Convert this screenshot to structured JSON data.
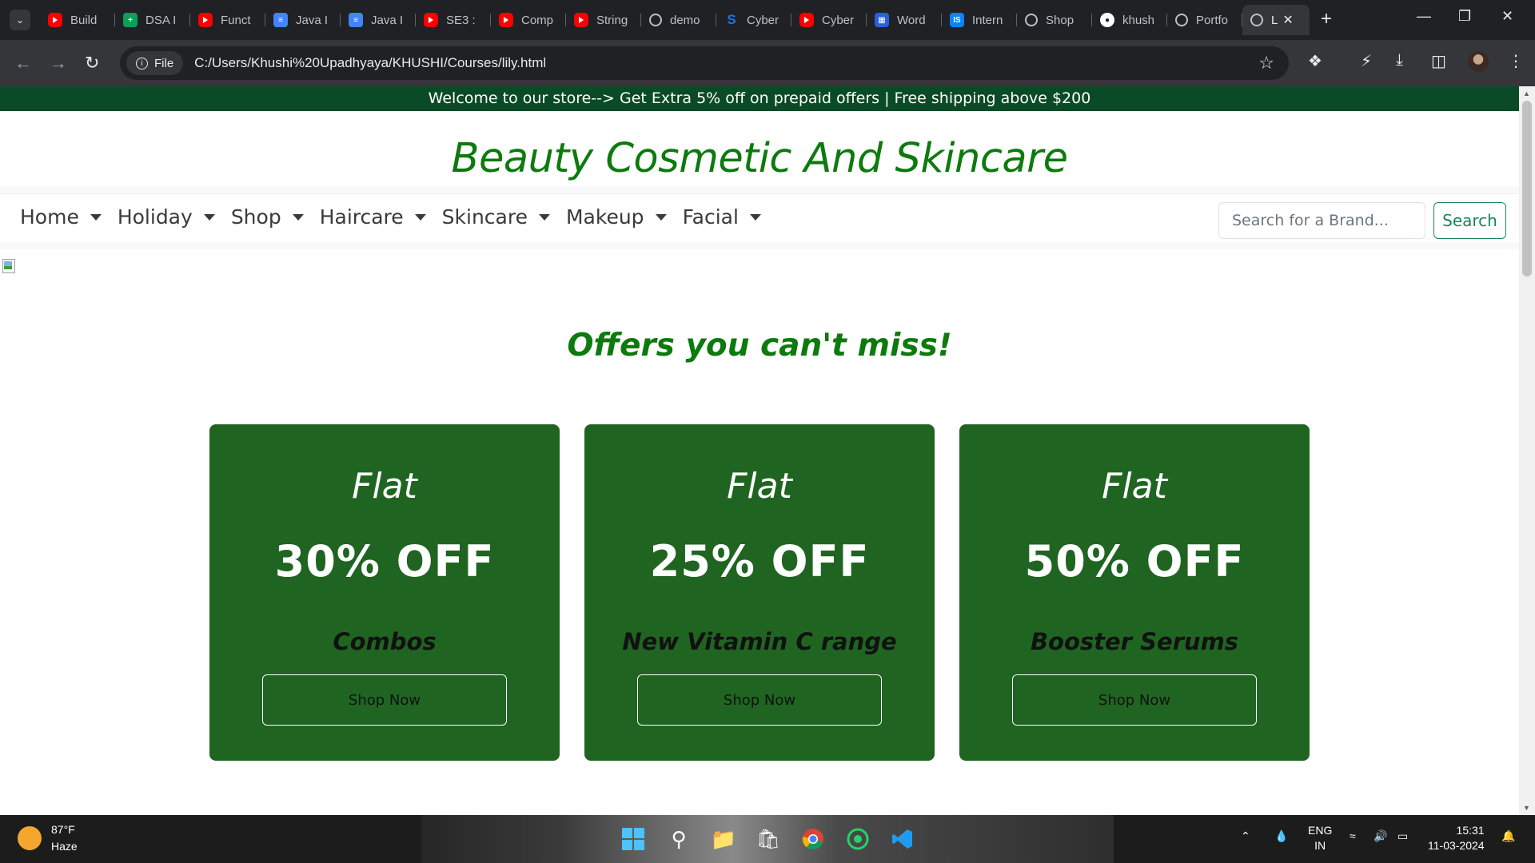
{
  "browser": {
    "tabs": [
      {
        "icon": "youtube-icon",
        "title": "Build"
      },
      {
        "icon": "sheets-icon",
        "title": "DSA I"
      },
      {
        "icon": "youtube-icon",
        "title": "Funct"
      },
      {
        "icon": "docs-icon",
        "title": "Java I"
      },
      {
        "icon": "docs-icon",
        "title": "Java I"
      },
      {
        "icon": "youtube-icon",
        "title": "SE3 :"
      },
      {
        "icon": "youtube-icon",
        "title": "Comp"
      },
      {
        "icon": "youtube-icon",
        "title": "String"
      },
      {
        "icon": "globe-icon",
        "title": "demo"
      },
      {
        "icon": "s-icon",
        "title": "Cyber"
      },
      {
        "icon": "youtube-icon",
        "title": "Cyber"
      },
      {
        "icon": "grid-icon",
        "title": "Word"
      },
      {
        "icon": "is-icon",
        "title": "Intern"
      },
      {
        "icon": "globe-icon",
        "title": "Shop"
      },
      {
        "icon": "github-icon",
        "title": "khush"
      },
      {
        "icon": "globe-icon",
        "title": "Portfo"
      }
    ],
    "active_tab_title": "L",
    "omnibox_chip": "File",
    "url": "C:/Users/Khushi%20Upadhyaya/KHUSHI/Courses/lily.html"
  },
  "site": {
    "banner": "Welcome to our store--> Get Extra 5% off on prepaid offers | Free shipping above $200",
    "brand": "Beauty Cosmetic And Skincare",
    "nav": [
      "Home",
      "Holiday",
      "Shop",
      "Haircare",
      "Skincare",
      "Makeup",
      "Facial"
    ],
    "search": {
      "placeholder": "Search for a Brand...",
      "button": "Search"
    },
    "offers_title": "Offers you can't miss!",
    "offers": [
      {
        "flat": "Flat",
        "discount": "30% OFF",
        "product": "Combos",
        "button": "Shop Now"
      },
      {
        "flat": "Flat",
        "discount": "25% OFF",
        "product": "New Vitamin C range",
        "button": "Shop Now"
      },
      {
        "flat": "Flat",
        "discount": "50% OFF",
        "product": "Booster Serums",
        "button": "Shop Now"
      }
    ]
  },
  "taskbar": {
    "weather_temp": "87°F",
    "weather_desc": "Haze",
    "lang_top": "ENG",
    "lang_bottom": "IN",
    "time": "15:31",
    "date": "11-03-2024"
  },
  "colors": {
    "banner_bg": "#0b4a26",
    "brand_green": "#0d7a0d",
    "card_bg": "#1f6521",
    "search_btn": "#198754"
  }
}
